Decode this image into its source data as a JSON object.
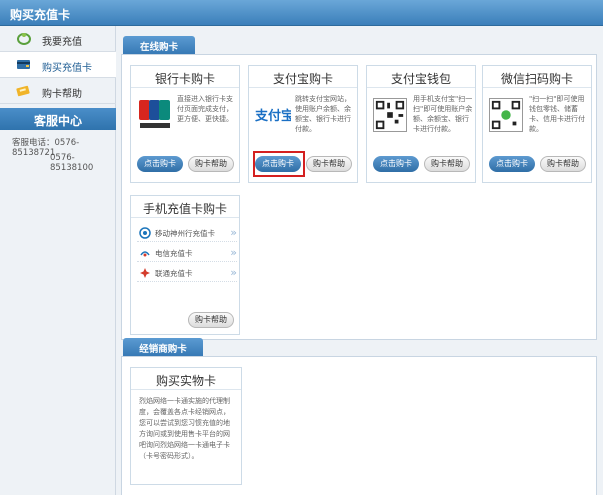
{
  "header": {
    "title": "购买充值卡"
  },
  "sidebar": {
    "items": [
      {
        "label": "我要充值",
        "icon": "bracelet-icon"
      },
      {
        "label": "购买充值卡",
        "icon": "card-icon"
      },
      {
        "label": "购卡帮助",
        "icon": "help-card-icon"
      }
    ],
    "service": {
      "title": "客服中心",
      "phone_label": "客服电话：",
      "phone1": "0576-85138721",
      "phone2": "0576-85138100"
    }
  },
  "online": {
    "tab_label": "在线购卡",
    "cards": [
      {
        "title": "银行卡购卡",
        "desc": "直接进入银行卡支付页面完成支付，更方便、更快捷。",
        "buy": "点击购卡",
        "help": "购卡帮助",
        "logo": "unionpay-logo"
      },
      {
        "title": "支付宝购卡",
        "desc": "跳转支付宝网站，使用账户余额、余额宝、银行卡进行付款。",
        "buy": "点击购卡",
        "help": "购卡帮助",
        "logo": "alipay-logo"
      },
      {
        "title": "支付宝钱包",
        "desc": "用手机支付宝\"扫一扫\"即可使用账户余额、余额宝、银行卡进行付款。",
        "buy": "点击购卡",
        "help": "购卡帮助",
        "logo": "qr-code"
      },
      {
        "title": "微信扫码购卡",
        "desc": "\"扫一扫\"即可使用钱包零钱、储蓄卡、信用卡进行付款。",
        "buy": "点击购卡",
        "help": "购卡帮助",
        "logo": "qr-code"
      }
    ],
    "mobile": {
      "title": "手机充值卡购卡",
      "items": [
        {
          "label": "移动神州行充值卡",
          "icon": "china-mobile-icon"
        },
        {
          "label": "电信充值卡",
          "icon": "china-telecom-icon"
        },
        {
          "label": "联通充值卡",
          "icon": "china-unicom-icon"
        }
      ],
      "help": "购卡帮助"
    }
  },
  "dealer": {
    "tab_label": "经销商购卡",
    "card": {
      "title": "购买实物卡",
      "desc": "烈焰网络一卡通实施的代理制度，会覆盖各点卡经销网点，您可以尝试到您习惯充值的地方询问或到使用售卡平台的网吧询问烈焰网络一卡通电子卡（卡号密码形式）。"
    }
  },
  "colors": {
    "accent": "#3779b5",
    "highlight": "#d42020"
  }
}
